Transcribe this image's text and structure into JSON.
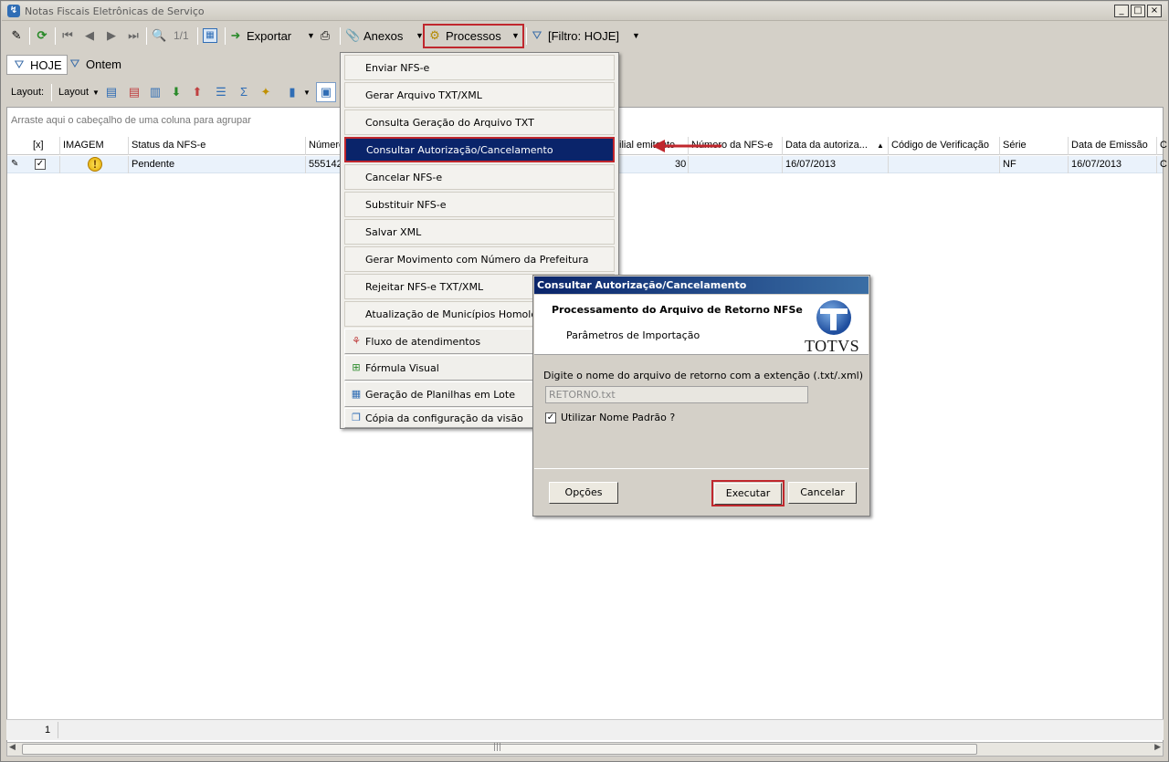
{
  "window": {
    "title": "Notas Fiscais Eletrônicas de Serviço",
    "controls": [
      "_",
      "□",
      "×"
    ]
  },
  "toolbar": {
    "record_counter": "1/1",
    "export_label": "Exportar",
    "attachments_label": "Anexos",
    "processes_label": "Processos",
    "filter_label": "[Filtro: HOJE]"
  },
  "filters": {
    "today_label": "HOJE",
    "yesterday_label": "Ontem"
  },
  "layout_bar": {
    "layout_prefix": "Layout:",
    "layout_dropdown": "Layout"
  },
  "grid": {
    "group_hint": "Arraste aqui o cabeçalho de uma coluna para agrupar",
    "columns": {
      "select": "[x]",
      "image": "IMAGEM",
      "status": "Status da NFS-e",
      "numero": "Número",
      "filial": "ilial emitente",
      "numero_nfse": "Número da NFS-e",
      "data_autorizacao": "Data da autoriza...",
      "codigo_verificacao": "Código de Verificação",
      "serie": "Série",
      "data_emissao": "Data de Emissão",
      "extra": "C"
    },
    "row": {
      "status": "Pendente",
      "numero": "555142",
      "filial": "30",
      "numero_nfse": "",
      "data_autorizacao": "16/07/2013",
      "codigo_verificacao": "",
      "serie": "NF",
      "data_emissao": "16/07/2013",
      "extra": "C"
    },
    "footer_count": "1"
  },
  "menu": {
    "items": [
      "Enviar NFS-e",
      "Gerar Arquivo TXT/XML",
      "Consulta Geração do Arquivo TXT",
      "Consultar Autorização/Cancelamento",
      "Cancelar NFS-e",
      "Substituir NFS-e",
      "Salvar XML",
      "Gerar Movimento com Número da Prefeitura",
      "Rejeitar NFS-e TXT/XML",
      "Atualização de Municípios Homologado",
      "Fluxo de atendimentos",
      "Fórmula Visual",
      "Geração de Planilhas em Lote",
      "Cópia da configuração da visão"
    ]
  },
  "dialog": {
    "title": "Consultar Autorização/Cancelamento",
    "header_title": "Processamento do Arquivo de Retorno NFSe",
    "header_subtitle": "Parâmetros de Importação",
    "logo_text": "TOTVS",
    "prompt": "Digite o nome do arquivo de retorno com a extenção (.txt/.xml)",
    "file_value": "RETORNO.txt",
    "use_default_label": "Utilizar Nome Padrão ?",
    "options_button": "Opções",
    "execute_button": "Executar",
    "cancel_button": "Cancelar"
  },
  "colors": {
    "accent_red": "#c0272d",
    "menu_active": "#0a246a",
    "brand_blue": "#1f4e9e"
  }
}
